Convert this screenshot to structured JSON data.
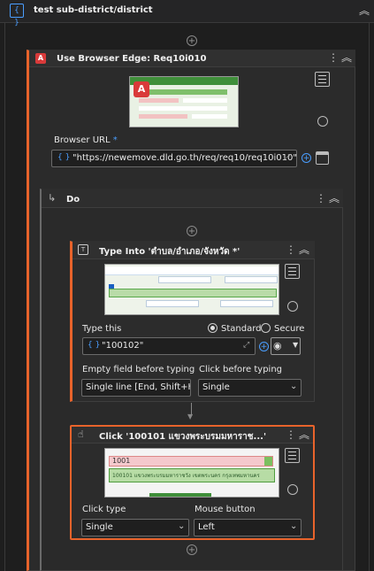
{
  "sequence": {
    "title": "test sub-district/district",
    "icon": "sequence-icon"
  },
  "browser": {
    "title": "Use Browser Edge: Req10i010",
    "url_label": "Browser URL",
    "required_mark": "*",
    "url_value": "\"https://newemove.dld.go.th/req/req10/req10i010\""
  },
  "do": {
    "title": "Do"
  },
  "type_into": {
    "title": "Type Into 'ตำบล/อำเภอ/จังหวัด *'",
    "type_this_label": "Type this",
    "radio_standard": "Standard",
    "radio_secure": "Secure",
    "value": "\"100102\"",
    "empty_field_label": "Empty field before typing",
    "empty_field_value": "Single line [End, Shift+H",
    "click_before_label": "Click before typing",
    "click_before_value": "Single"
  },
  "click": {
    "title": "Click '100101 แขวงพระบรมมหาราช...'",
    "click_type_label": "Click type",
    "click_type_value": "Single",
    "mouse_button_label": "Mouse button",
    "mouse_button_value": "Left",
    "thumb_text": "100101 แขวงพระบรมมหาราชวัง เขตพระนคร กรุงเทพมหานคร",
    "thumb_input": "1001"
  },
  "colors": {
    "accent": "#e8632b",
    "link": "#4a9eff",
    "card": "#2b2b2b"
  }
}
